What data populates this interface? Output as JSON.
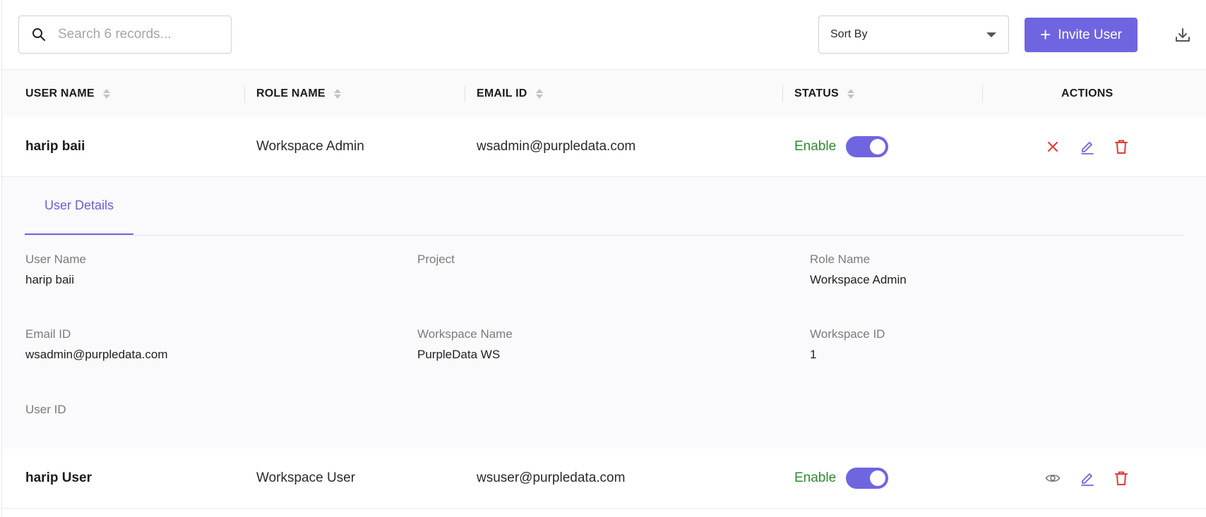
{
  "toolbar": {
    "search_placeholder": "Search 6 records...",
    "sort_label": "Sort By",
    "invite_label": "Invite User",
    "icons": [
      "search-icon",
      "chevron-down-icon",
      "plus-icon",
      "download-icon"
    ]
  },
  "table": {
    "headers": [
      "USER NAME",
      "ROLE NAME",
      "EMAIL ID",
      "STATUS",
      "ACTIONS"
    ],
    "rows": [
      {
        "user_name": "harip baii",
        "role_name": "Workspace Admin",
        "email": "wsadmin@purpledata.com",
        "status": "Enable",
        "enabled": true,
        "actions": [
          "close-icon",
          "edit-icon",
          "delete-icon"
        ]
      },
      {
        "user_name": "harip User",
        "role_name": "Workspace User",
        "email": "wsuser@purpledata.com",
        "status": "Enable",
        "enabled": true,
        "actions": [
          "eye-icon",
          "edit-icon",
          "delete-icon"
        ]
      }
    ]
  },
  "details": {
    "tab_label": "User Details",
    "fields": [
      {
        "label": "User Name",
        "value": "harip baii"
      },
      {
        "label": "Project",
        "value": ""
      },
      {
        "label": "Role Name",
        "value": "Workspace Admin"
      },
      {
        "label": "Email ID",
        "value": "wsadmin@purpledata.com"
      },
      {
        "label": "Workspace Name",
        "value": "PurpleData WS"
      },
      {
        "label": "Workspace ID",
        "value": "1"
      },
      {
        "label": "User ID",
        "value": ""
      }
    ]
  },
  "colors": {
    "accent": "#7065e0",
    "status_green": "#2e8b2e",
    "danger": "#e53935"
  }
}
